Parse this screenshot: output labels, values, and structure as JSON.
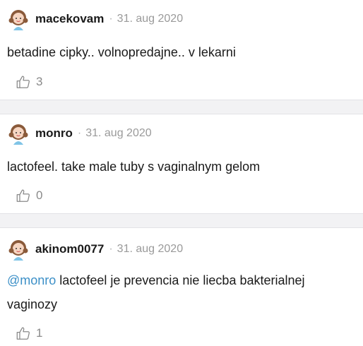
{
  "comments": [
    {
      "username": "macekovam",
      "separator": "·",
      "date": "31. aug 2020",
      "text": "betadine cipky.. volnopredajne.. v lekarni",
      "likes": "3"
    },
    {
      "username": "monro",
      "separator": "·",
      "date": "31. aug 2020",
      "text": "lactofeel. take male tuby s vaginalnym gelom",
      "likes": "0"
    },
    {
      "username": "akinom0077",
      "separator": "·",
      "date": "31. aug 2020",
      "mention": "@monro",
      "text": " lactofeel je prevencia nie liecba bakterialnej vaginozy",
      "likes": "1"
    }
  ],
  "icons": {
    "avatar": "girl-avatar-icon",
    "like": "thumbs-up-icon"
  }
}
